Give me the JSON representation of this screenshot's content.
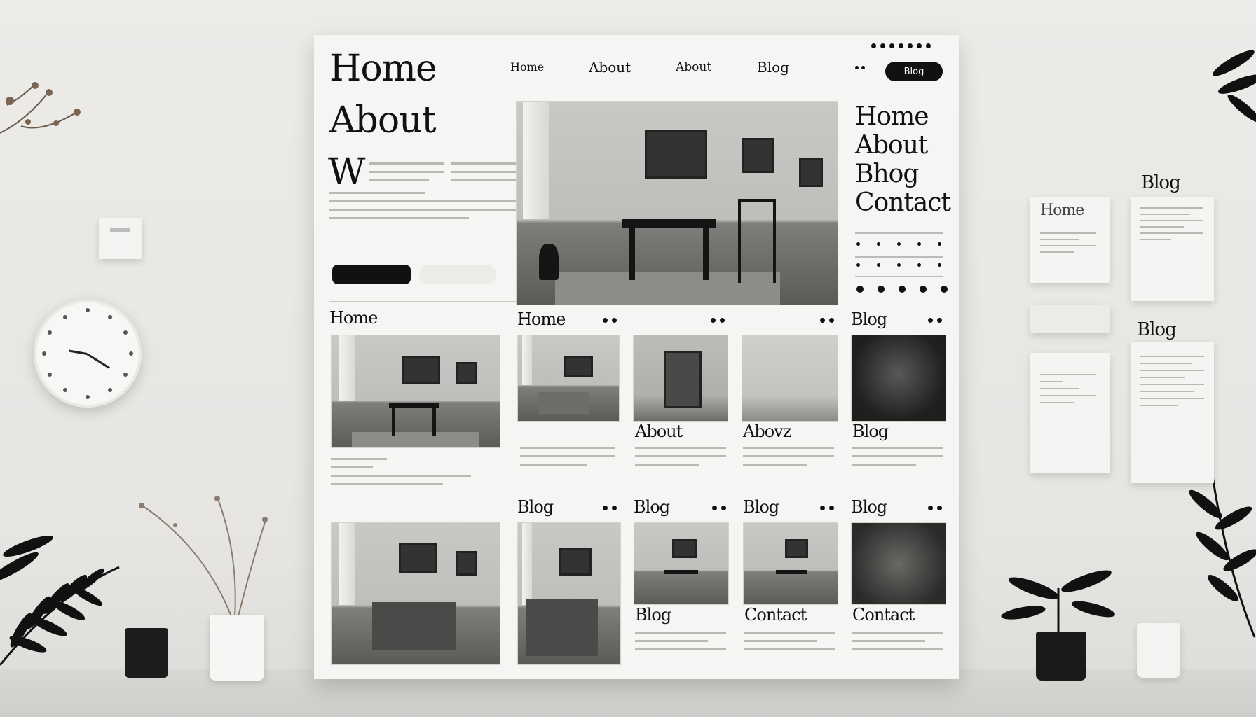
{
  "board": {
    "big_menu": {
      "home": "Home",
      "about": "About",
      "drop_cap": "W"
    },
    "nav": {
      "home": "Home",
      "about": "About",
      "about2": "About",
      "blog": "Blog",
      "button": "Blog"
    },
    "hero_button": "",
    "right_menu": [
      "Home",
      "About",
      "Bhog",
      "Contact"
    ],
    "row1": {
      "left_header": "Home",
      "col2_header": "Home",
      "col5_header": "Blog",
      "captions": [
        "About",
        "Abovz",
        "Blog"
      ]
    },
    "row2": {
      "headers": [
        "Blog",
        "Blog",
        "Blog",
        "Blog"
      ],
      "captions": [
        "Blog",
        "Contact",
        "Contact"
      ]
    }
  },
  "wall": {
    "papers": {
      "home_title": "Home",
      "blog_label_1": "Blog",
      "blog_label_2": "Blog"
    }
  },
  "colors": {
    "ink": "#111111",
    "board": "#f5f5f3",
    "wall": "#e8e7e4"
  }
}
